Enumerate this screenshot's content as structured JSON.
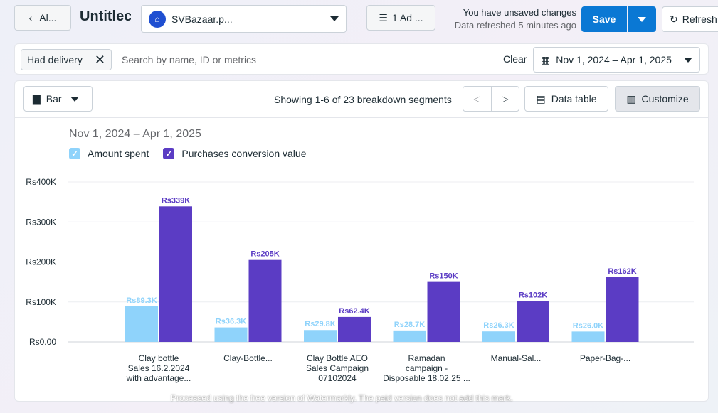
{
  "header": {
    "back_label": "Al...",
    "title": "Untitlec",
    "account": {
      "name": "SVBazaar.p...",
      "icon": "store-icon"
    },
    "ad_count_label": "1 Ad ...",
    "status_line1": "You have unsaved changes",
    "status_line2": "Data refreshed 5 minutes ago",
    "save_label": "Save",
    "refresh_label": "Refresh"
  },
  "filters": {
    "chip_label": "Had delivery",
    "search_placeholder": "Search by name, ID or metrics",
    "clear_label": "Clear",
    "date_range": "Nov 1, 2024 – Apr 1, 2025"
  },
  "toolbar": {
    "chart_type_label": "Bar",
    "segments_text": "Showing 1-6 of 23 breakdown segments",
    "data_table_label": "Data table",
    "customize_label": "Customize"
  },
  "chart_header": {
    "range_label": "Nov 1, 2024 – Apr 1, 2025"
  },
  "chart_data": {
    "type": "bar",
    "categories": [
      [
        "Clay bottle",
        "Sales 16.2.2024",
        "with advantage..."
      ],
      [
        "Clay-Bottle..."
      ],
      [
        "Clay Bottle AEO",
        "Sales Campaign",
        "07102024"
      ],
      [
        "Ramadan",
        "campaign -",
        "Disposable 18.02.25 ..."
      ],
      [
        "Manual-Sal..."
      ],
      [
        "Paper-Bag-..."
      ]
    ],
    "series": [
      {
        "name": "Amount spent",
        "color": "#8fd3fb",
        "values": [
          89300,
          36300,
          29800,
          28700,
          26300,
          26000
        ],
        "labels": [
          "Rs89.3K",
          "Rs36.3K",
          "Rs29.8K",
          "Rs28.7K",
          "Rs26.3K",
          "Rs26.0K"
        ]
      },
      {
        "name": "Purchases conversion value",
        "color": "#5b3cc4",
        "values": [
          339000,
          205000,
          62400,
          150000,
          102000,
          162000
        ],
        "labels": [
          "Rs339K",
          "Rs205K",
          "Rs62.4K",
          "Rs150K",
          "Rs102K",
          "Rs162K"
        ]
      }
    ],
    "yticks": [
      "Rs0.00",
      "Rs100K",
      "Rs200K",
      "Rs300K",
      "Rs400K"
    ],
    "ylim": [
      0,
      400000
    ],
    "grid": true,
    "legend_position": "top-left"
  },
  "footer_note": "Processed using the free version of Watermarkly. The paid version does not add this mark."
}
